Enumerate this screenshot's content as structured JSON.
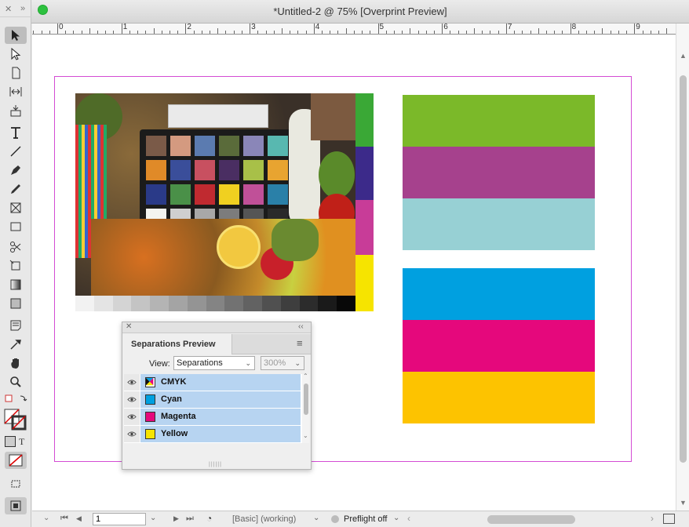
{
  "window": {
    "title": "*Untitled-2 @ 75% [Overprint Preview]"
  },
  "toolbar": {
    "close_glyph": "✕",
    "collapse_glyph": "»",
    "tools": [
      {
        "name": "selection-tool-icon"
      },
      {
        "name": "direct-selection-tool-icon"
      },
      {
        "name": "page-tool-icon"
      },
      {
        "name": "gap-tool-icon"
      },
      {
        "name": "content-collector-tool-icon"
      },
      {
        "name": "type-tool-icon"
      },
      {
        "name": "line-tool-icon"
      },
      {
        "name": "pen-tool-icon"
      },
      {
        "name": "pencil-tool-icon"
      },
      {
        "name": "rectangle-frame-tool-icon"
      },
      {
        "name": "rectangle-tool-icon"
      },
      {
        "name": "scissors-tool-icon"
      },
      {
        "name": "free-transform-tool-icon"
      },
      {
        "name": "gradient-swatch-tool-icon"
      },
      {
        "name": "gradient-feather-tool-icon"
      },
      {
        "name": "note-tool-icon"
      },
      {
        "name": "eyedropper-tool-icon"
      },
      {
        "name": "hand-tool-icon"
      },
      {
        "name": "zoom-tool-icon"
      }
    ],
    "text_formatting_glyph": "T"
  },
  "ruler": {
    "labels": [
      "0",
      "1",
      "2",
      "3",
      "4",
      "5",
      "6",
      "7",
      "8",
      "9"
    ]
  },
  "document": {
    "image": {
      "color_checker": [
        "#7a5a48",
        "#d49a80",
        "#5b7bb0",
        "#5a6b3a",
        "#8a86b8",
        "#58b8b0",
        "#e08a28",
        "#3a4e9a",
        "#c85060",
        "#4a2e62",
        "#a8c048",
        "#e8a430",
        "#2a3a88",
        "#4a9048",
        "#c02a30",
        "#f0d020",
        "#c05098",
        "#2a80a8",
        "#f4f4f0",
        "#cfcfcf",
        "#a8a8a8",
        "#7c7c7c",
        "#555555",
        "#2a2a2a"
      ],
      "side_strip": [
        "#3aa836",
        "#3c2a8a",
        "#c83c98",
        "#f6e400"
      ],
      "gray_ramp": [
        "#f2f2f2",
        "#e4e4e4",
        "#d4d4d4",
        "#c4c4c4",
        "#b4b4b4",
        "#a4a4a4",
        "#949494",
        "#848484",
        "#727272",
        "#626262",
        "#505050",
        "#3e3e3e",
        "#2c2c2c",
        "#1a1a1a",
        "#080808"
      ]
    },
    "bars_top": [
      "#7bb929",
      "#a6418d",
      "#97d0d4"
    ],
    "bars_bottom": [
      "#00a0e0",
      "#e5087c",
      "#fdc300"
    ]
  },
  "separations_panel": {
    "title": "Separations Preview",
    "close_glyph": "✕",
    "collapse_glyph": "‹‹",
    "menu_glyph": "≡",
    "view_label": "View:",
    "view_value": "Separations",
    "zoom_value": "300%",
    "separations": [
      {
        "name": "CMYK",
        "color": "cmyk"
      },
      {
        "name": "Cyan",
        "color": "#00a0e0"
      },
      {
        "name": "Magenta",
        "color": "#e5087c"
      },
      {
        "name": "Yellow",
        "color": "#f6e400"
      }
    ],
    "resize_glyph": "||||||"
  },
  "statusbar": {
    "page_number": "1",
    "style": "[Basic] (working)",
    "preflight": "Preflight off",
    "first_glyph": "⏮",
    "prev_glyph": "◀",
    "next_glyph": "▶",
    "last_glyph": "⏭"
  }
}
